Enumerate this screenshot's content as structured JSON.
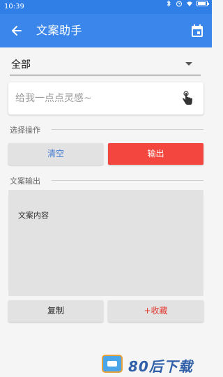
{
  "status_bar": {
    "time": "10:39"
  },
  "app_bar": {
    "title": "文案助手"
  },
  "category_select": {
    "value": "全部"
  },
  "prompt_input": {
    "placeholder": "给我一点点灵感~",
    "value": ""
  },
  "actions_section": {
    "label": "选择操作"
  },
  "actions": {
    "clear_label": "清空",
    "output_label": "输出"
  },
  "output_section": {
    "label": "文案输出"
  },
  "output_box": {
    "content": "文案内容"
  },
  "bottom_actions": {
    "copy_label": "复制",
    "favorite_label": "+收藏"
  },
  "watermark": {
    "text": "80后下载"
  },
  "colors": {
    "app_bar": "#3a86ea",
    "output_button": "#f2463e",
    "clear_text": "#4a7fd4",
    "favorite_text": "#e33b33"
  },
  "icons": [
    "back-arrow-icon",
    "calendar-icon",
    "tap-hand-icon",
    "chevron-down-icon",
    "bluetooth-icon",
    "wifi-icon",
    "battery-icon"
  ]
}
